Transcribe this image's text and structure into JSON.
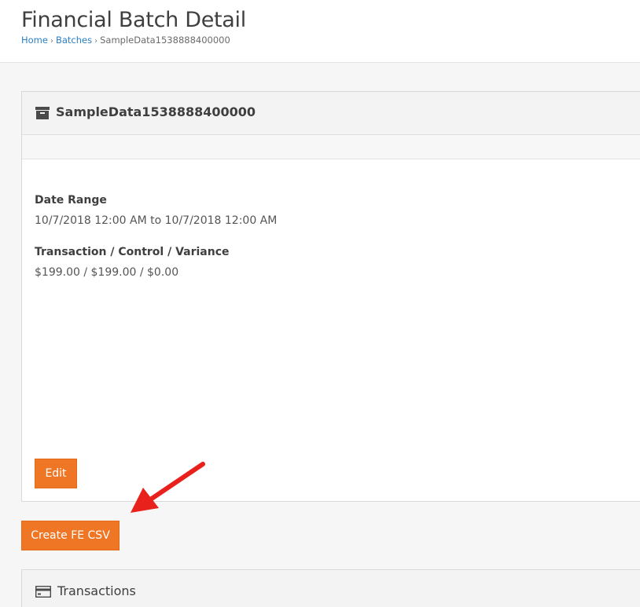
{
  "header": {
    "title": "Financial Batch Detail",
    "breadcrumb": [
      "Home",
      "Batches",
      "SampleData1538888400000"
    ]
  },
  "batch_panel": {
    "title": "SampleData1538888400000",
    "icon": "archive-icon",
    "fields": [
      {
        "label": "Date Range",
        "value": "10/7/2018 12:00 AM to 10/7/2018 12:00 AM"
      },
      {
        "label": "Transaction / Control / Variance",
        "value": "$199.00 / $199.00 / $0.00"
      }
    ],
    "edit_label": "Edit"
  },
  "actions": {
    "create_csv_label": "Create FE CSV"
  },
  "transactions_panel": {
    "title": "Transactions",
    "icon": "credit-card-icon"
  },
  "colors": {
    "accent": "#ee7624",
    "link": "#2b7fc4",
    "annotation_arrow": "#e8211c"
  }
}
